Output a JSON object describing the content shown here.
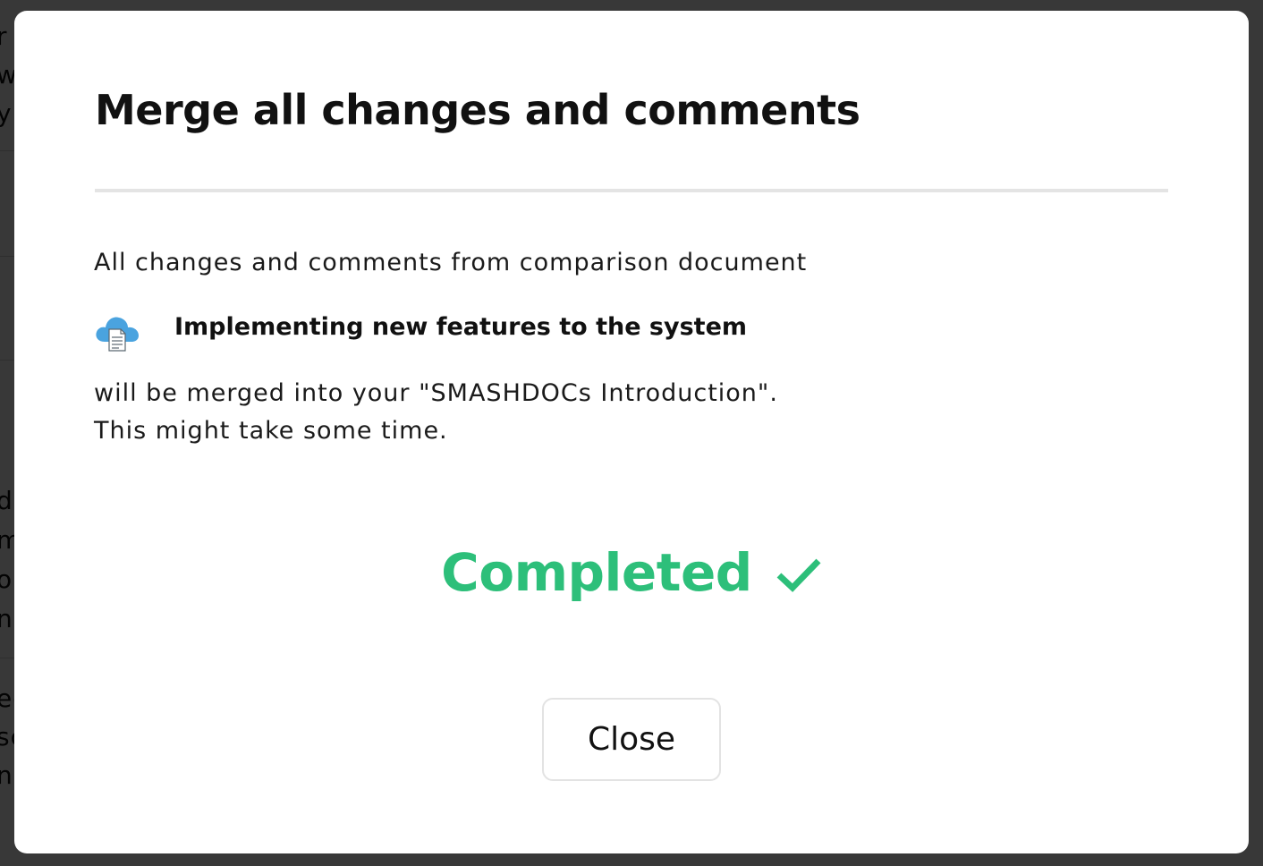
{
  "background": {
    "fragments": [
      "r",
      "w",
      "y",
      "d",
      "m",
      "or",
      "nc",
      "ec",
      "sc",
      "n"
    ]
  },
  "dialog": {
    "title": "Merge all changes and comments",
    "description_line_1": "All changes and comments from comparison document",
    "document": {
      "icon": "cloud-document-icon",
      "title": "Implementing new features to the system"
    },
    "description_line_2": "will be merged into your \"SMASHDOCs Introduction\".",
    "description_line_3": "This might take some time.",
    "status": {
      "label": "Completed",
      "icon": "checkmark-icon",
      "color": "#2dbf7a"
    },
    "close_button_label": "Close"
  },
  "colors": {
    "overlay": "#000000",
    "cloud": "#4aa3df",
    "success": "#2dbf7a"
  }
}
